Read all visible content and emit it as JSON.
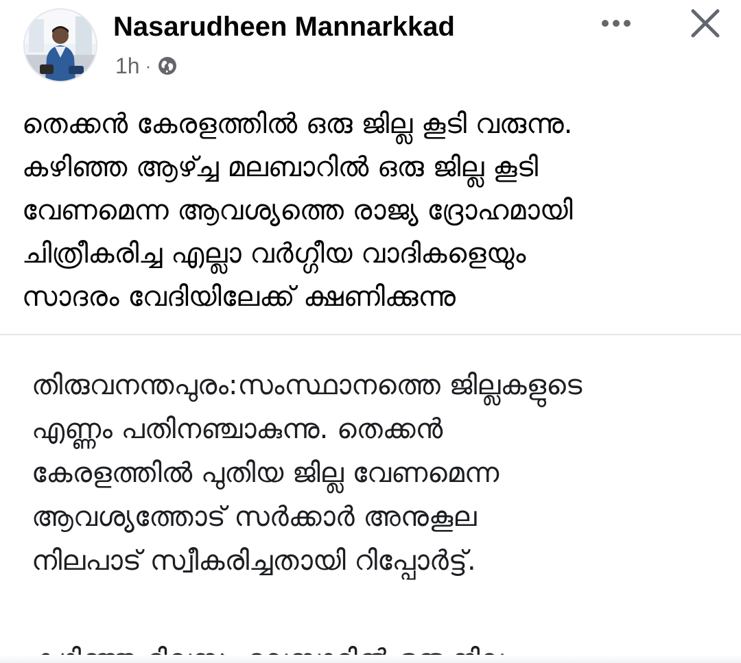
{
  "post": {
    "author_name": "Nasarudheen Mannarkkad",
    "time": "1h",
    "separator": "·",
    "privacy_icon": "globe-icon",
    "avatar_icon": "profile-photo",
    "menu_icon": "more-options-icon",
    "close_icon": "close-icon",
    "text_lines": [
      "തെക്കൻ കേരളത്തിൽ ഒരു ജില്ല കൂടി വരുന്നു.",
      "കഴിഞ്ഞ ആഴ്ച്ച മലബാറിൽ ഒരു ജില്ല കൂടി",
      "വേണമെന്ന ആവശ്യത്തെ രാജ്യ ദ്രോഹമായി",
      "ചിത്രീകരിച്ച എല്ലാ വർഗ്ഗീയ വാദികളെയും",
      "സാദരം വേദിയിലേക്ക് ക്ഷണിക്കുന്നു"
    ]
  },
  "shared_content": {
    "text_lines": [
      "തിരുവനന്തപുരം:സംസ്ഥാനത്തെ ജില്ലകളുടെ",
      "എണ്ണം പതിനഞ്ചാകുന്നു. തെക്കൻ",
      "കേരളത്തിൽ പുതിയ ജില്ല വേണമെന്ന",
      "ആവശ്യത്തോട് സർക്കാർ അനുകൂല",
      "നിലപാട് സ്വീകരിച്ചതായി റിപ്പോർട്ട്."
    ],
    "cut_off_line": "കഴിഞ്ഞ ദിവസം മലബാറിൽ ഒരു ജില്ല"
  },
  "colors": {
    "text_primary": "#050505",
    "text_secondary": "#65676b",
    "divider": "#e4e6eb",
    "icon_gray": "#606770"
  }
}
